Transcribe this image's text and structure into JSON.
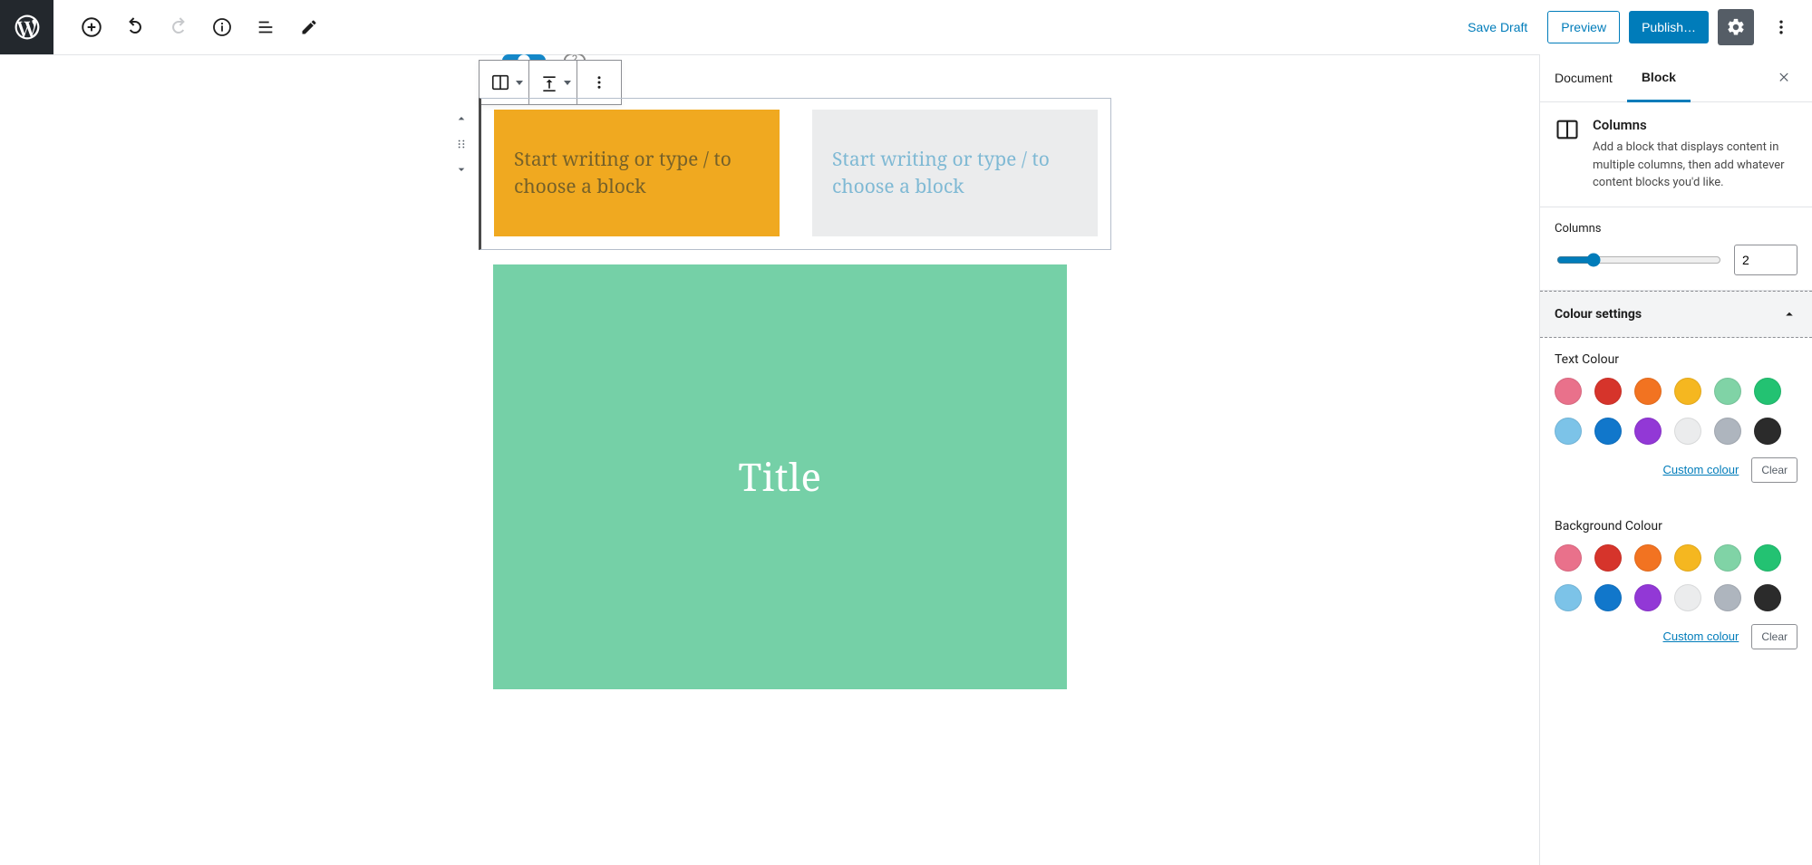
{
  "topbar": {
    "save_draft": "Save Draft",
    "preview": "Preview",
    "publish": "Publish…"
  },
  "editor": {
    "column_a_placeholder": "Start writing or type / to choose a block",
    "column_b_placeholder": "Start writing or type / to choose a block",
    "cover_title": "Title"
  },
  "sidebar": {
    "tab_document": "Document",
    "tab_block": "Block",
    "block_card": {
      "title": "Columns",
      "description": "Add a block that displays content in multiple columns, then add whatever content blocks you'd like."
    },
    "columns": {
      "label": "Columns",
      "value": "2"
    },
    "colour_settings": {
      "title": "Colour settings",
      "text_label": "Text Colour",
      "bg_label": "Background Colour",
      "custom": "Custom colour",
      "clear": "Clear"
    },
    "palette": {
      "row1": [
        "#e9718b",
        "#d6342b",
        "#f27321",
        "#f5b720",
        "#80d3a6",
        "#23c272"
      ],
      "row2": [
        "#7cc3e8",
        "#1177cb",
        "#9238d6",
        "#ebeced",
        "#aeb5be",
        "#2b2b2b"
      ]
    }
  }
}
